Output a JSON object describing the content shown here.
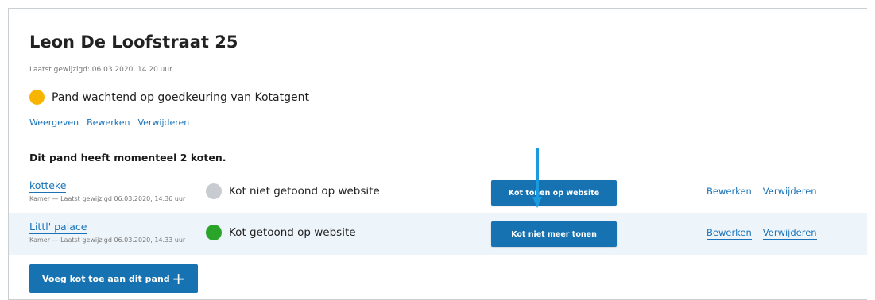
{
  "property": {
    "title": "Leon De Loofstraat 25",
    "last_modified": "Laatst gewijzigd: 06.03.2020, 14.20 uur",
    "status": {
      "text": "Pand wachtend op goedkeuring van Kotatgent",
      "color": "#f7b500"
    },
    "links": {
      "view": "Weergeven",
      "edit": "Bewerken",
      "delete": "Verwijderen"
    }
  },
  "rooms_count_text": "Dit pand heeft momenteel 2 koten.",
  "rooms": [
    {
      "name": "kotteke",
      "meta": "Kamer — Laatst gewijzigd 06.03.2020, 14.36 uur",
      "status_text": "Kot niet getoond op website",
      "status_color": "#c8cbcf",
      "button_label": "Kot tonen op website",
      "edit_label": "Bewerken",
      "delete_label": "Verwijderen"
    },
    {
      "name": "Littl' palace",
      "meta": "Kamer — Laatst gewijzigd 06.03.2020, 14.33 uur",
      "status_text": "Kot getoond op website",
      "status_color": "#2aa52a",
      "button_label": "Kot niet meer tonen",
      "edit_label": "Bewerken",
      "delete_label": "Verwijderen"
    }
  ],
  "add_button": {
    "label": "Voeg kot toe aan dit pand",
    "icon": "plus-icon"
  },
  "colors": {
    "accent": "#1672b0",
    "link": "#1a73b8",
    "row_highlight": "#eef5fa"
  }
}
